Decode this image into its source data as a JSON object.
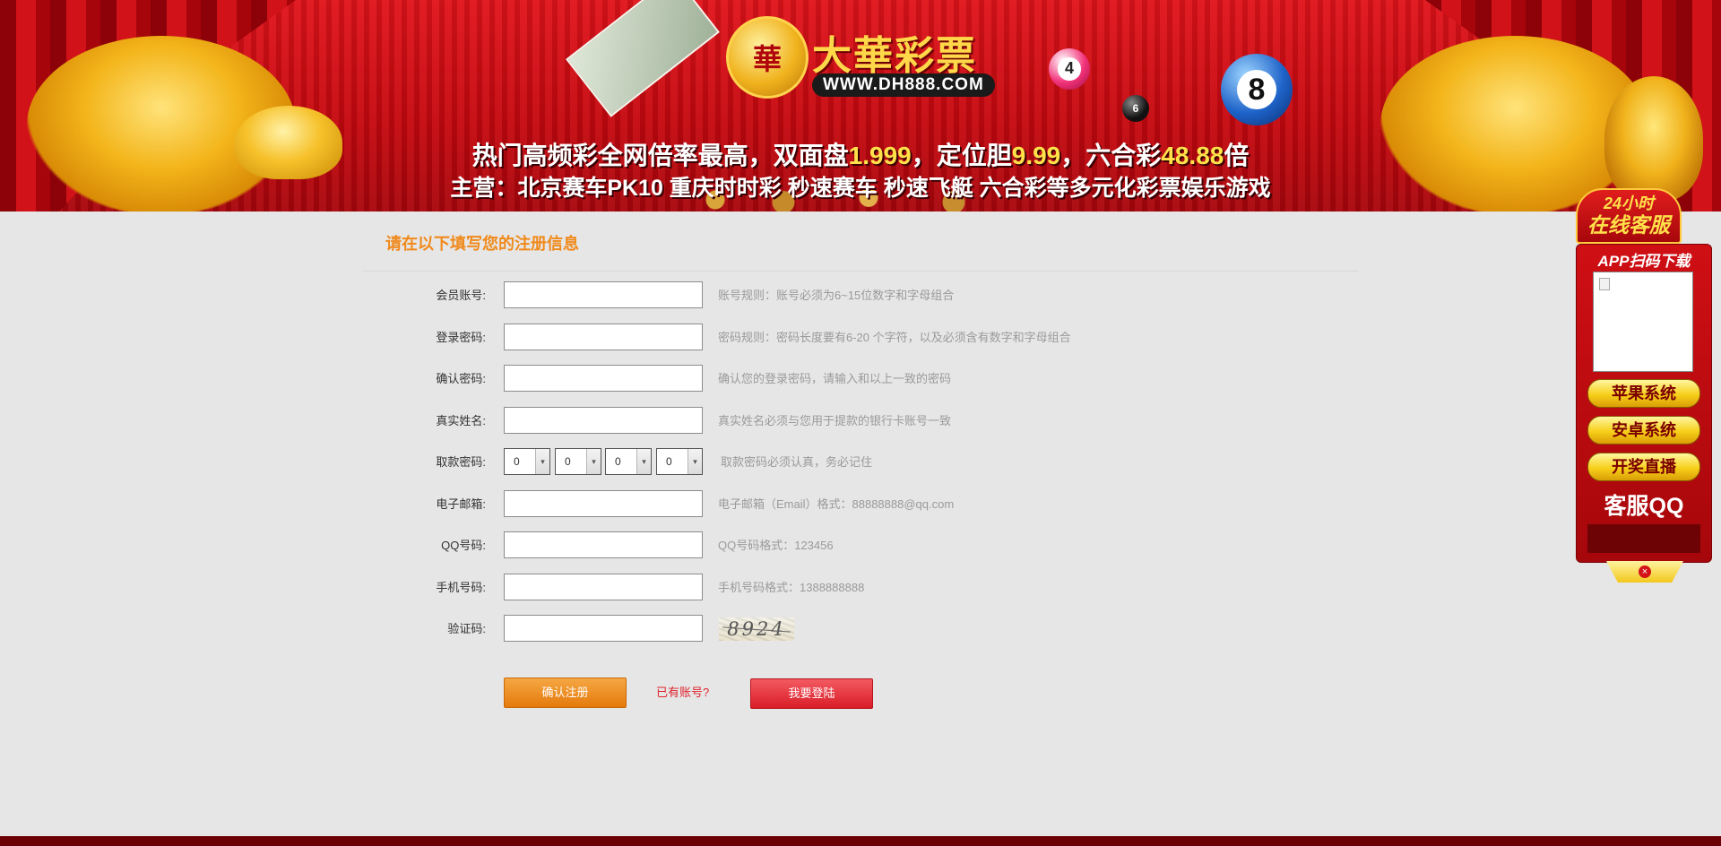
{
  "banner": {
    "logo_char": "華",
    "logo_title": "大華彩票",
    "logo_url": "WWW.DH888.COM",
    "slogan1_a": "热门高频彩全网倍率最高，双面盘",
    "slogan1_b": "1.999",
    "slogan1_c": "，定位胆",
    "slogan1_d": "9.99",
    "slogan1_e": "，六合彩",
    "slogan1_f": "48.88",
    "slogan1_g": "倍",
    "slogan2": "主营：北京赛车PK10 重庆时时彩 秒速赛车 秒速飞艇 六合彩等多元化彩票娱乐游戏",
    "ball_pink": "4",
    "ball_small": "6",
    "ball_blue": "8"
  },
  "form": {
    "title": "请在以下填写您的注册信息",
    "rows": [
      {
        "label": "会员账号:",
        "hint": "账号规则：账号必须为6~15位数字和字母组合",
        "value": ""
      },
      {
        "label": "登录密码:",
        "hint": "密码规则：密码长度要有6-20 个字符，以及必须含有数字和字母组合",
        "value": ""
      },
      {
        "label": "确认密码:",
        "hint": "确认您的登录密码，请输入和以上一致的密码",
        "value": ""
      },
      {
        "label": "真实姓名:",
        "hint": "真实姓名必须与您用于提款的银行卡账号一致",
        "value": ""
      },
      {
        "label": "取款密码:",
        "hint": "取款密码必须认真，务必记住",
        "selects": [
          "0",
          "0",
          "0",
          "0"
        ]
      },
      {
        "label": "电子邮箱:",
        "hint": "电子邮箱（Email）格式：88888888@qq.com",
        "value": ""
      },
      {
        "label": "QQ号码:",
        "hint": "QQ号码格式：123456",
        "value": ""
      },
      {
        "label": "手机号码:",
        "hint": "手机号码格式：1388888888",
        "value": ""
      },
      {
        "label": "验证码:",
        "captcha": "8924",
        "value": ""
      }
    ],
    "submit_label": "确认注册",
    "have_account": "已有账号?",
    "login_label": "我要登陆"
  },
  "sidebar": {
    "head_line1": "24小时",
    "head_line2": "在线客服",
    "app_title": "APP扫码下载",
    "buttons": [
      "苹果系统",
      "安卓系统",
      "开奖直播"
    ],
    "kefu_qq": "客服QQ",
    "close": "×"
  },
  "colors": {
    "accent_orange": "#f08a1c",
    "accent_red": "#e0222c",
    "banner_red": "#c4080f",
    "footer": "#6b0004"
  }
}
